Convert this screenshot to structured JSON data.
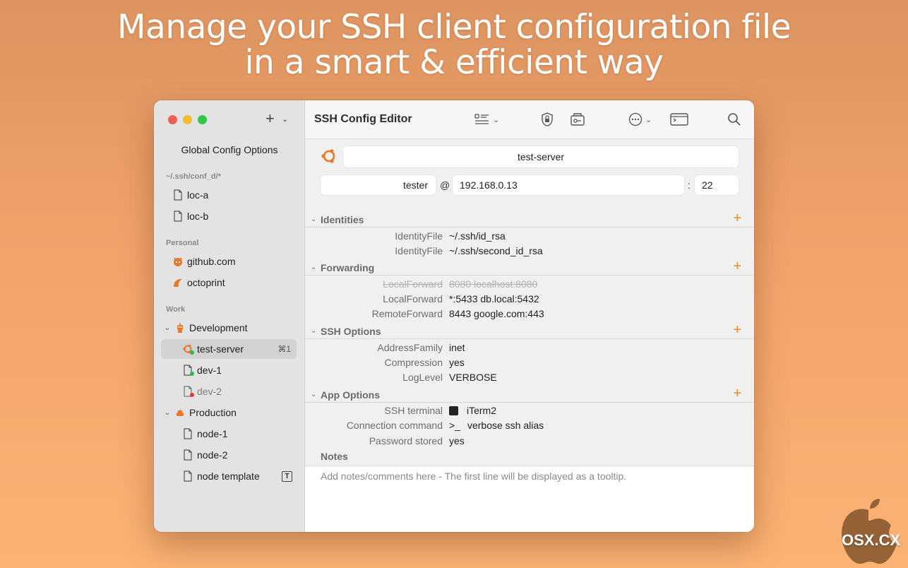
{
  "headline": {
    "line1": "Manage your SSH client configuration file",
    "line2": "in a smart & efficient way"
  },
  "sidebar": {
    "add_icon": "plus-icon",
    "global_config": "Global Config Options",
    "sections": [
      {
        "title": "~/.ssh/conf_d/*",
        "items": [
          {
            "label": "loc-a",
            "icon": "file-icon"
          },
          {
            "label": "loc-b",
            "icon": "file-icon"
          }
        ]
      },
      {
        "title": "Personal",
        "items": [
          {
            "label": "github.com",
            "icon": "github-octocat-icon"
          },
          {
            "label": "octoprint",
            "icon": "octoprint-icon"
          }
        ]
      },
      {
        "title": "Work",
        "groups": [
          {
            "label": "Development",
            "icon": "robot-icon",
            "items": [
              {
                "label": "test-server",
                "icon": "ubuntu-icon",
                "shortcut": "⌘1",
                "selected": true
              },
              {
                "label": "dev-1",
                "icon": "file-icon",
                "status": "green"
              },
              {
                "label": "dev-2",
                "icon": "file-icon",
                "status": "red",
                "dim": true
              }
            ]
          },
          {
            "label": "Production",
            "icon": "poop-icon",
            "items": [
              {
                "label": "node-1",
                "icon": "file-icon"
              },
              {
                "label": "node-2",
                "icon": "file-icon"
              },
              {
                "label": "node template",
                "icon": "file-icon",
                "badge": "T"
              }
            ]
          }
        ]
      }
    ]
  },
  "toolbar": {
    "title": "SSH Config Editor"
  },
  "host": {
    "name": "test-server",
    "user": "tester",
    "at": "@",
    "address": "192.168.0.13",
    "colon": ":",
    "port": "22"
  },
  "groups": [
    {
      "title": "Identities",
      "rows": [
        {
          "key": "IdentityFile",
          "value": "~/.ssh/id_rsa"
        },
        {
          "key": "IdentityFile",
          "value": "~/.ssh/second_id_rsa"
        }
      ]
    },
    {
      "title": "Forwarding",
      "rows": [
        {
          "key": "LocalForward",
          "value": "8080 localhost:8080",
          "disabled": true
        },
        {
          "key": "LocalForward",
          "value": "*:5433 db.local:5432"
        },
        {
          "key": "RemoteForward",
          "value": "8443 google.com:443"
        }
      ]
    },
    {
      "title": "SSH Options",
      "rows": [
        {
          "key": "AddressFamily",
          "value": "inet"
        },
        {
          "key": "Compression",
          "value": "yes"
        },
        {
          "key": "LogLevel",
          "value": "VERBOSE"
        }
      ]
    },
    {
      "title": "App Options",
      "rows": [
        {
          "key": "SSH terminal",
          "value": "iTerm2",
          "icon": "iterm-icon"
        },
        {
          "key": "Connection command",
          "value": "verbose ssh alias",
          "prefix": ">_"
        },
        {
          "key": "Password stored",
          "value": "yes"
        }
      ]
    }
  ],
  "notes": {
    "title": "Notes",
    "placeholder": "Add notes/comments here - The first line will be displayed as a tooltip."
  },
  "watermark": "OSX.CX",
  "colors": {
    "accent": "#f0892a",
    "selection": "#d3d2d2",
    "status_green": "#2db84d",
    "status_red": "#e53935"
  }
}
